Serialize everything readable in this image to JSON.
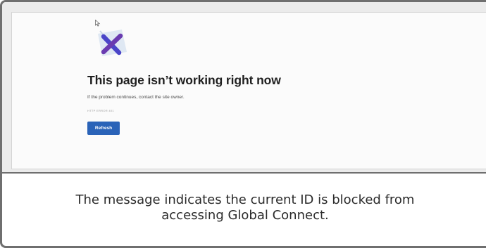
{
  "error_page": {
    "icon": "error-x-icon",
    "title": "This page isn’t working right now",
    "message": "If the problem continues, contact the site owner.",
    "error_code": "HTTP ERROR 401",
    "refresh_label": "Refresh"
  },
  "caption": {
    "text": "The message indicates the current ID is blocked from accessing Global Connect."
  },
  "colors": {
    "frame_border": "#6f6f6f",
    "refresh_button": "#2a63b8",
    "icon_x": "#5a3fb5",
    "icon_sheet": "#dfe8f3"
  }
}
